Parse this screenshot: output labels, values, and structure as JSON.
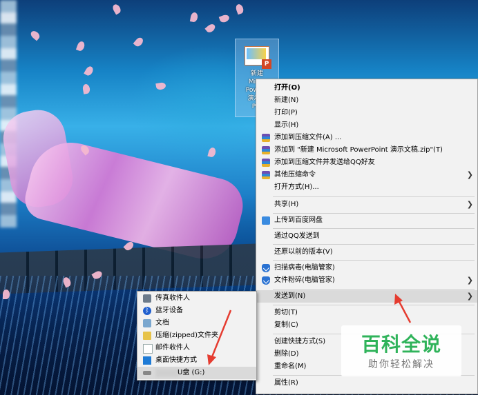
{
  "desktop": {
    "file_icon": {
      "name": "新建\nMic…\nPowe…\n演示…\nP…",
      "thumb_badge": "P"
    }
  },
  "main_menu": {
    "items": [
      {
        "label": "打开(O)"
      },
      {
        "label": "新建(N)"
      },
      {
        "label": "打印(P)"
      },
      {
        "label": "显示(H)"
      },
      {
        "label": "添加到压缩文件(A) ...",
        "icon": "winrar-icon"
      },
      {
        "label": "添加到 \"新建 Microsoft PowerPoint 演示文稿.zip\"(T)",
        "icon": "winrar-icon"
      },
      {
        "label": "添加到压缩文件并发送给QQ好友",
        "icon": "winrar-icon"
      },
      {
        "label": "其他压缩命令",
        "icon": "winrar-icon"
      },
      {
        "label": "打开方式(H)..."
      },
      {
        "label": "共享(H)"
      },
      {
        "label": "上传到百度网盘",
        "icon": "baidu-cloud-icon"
      },
      {
        "label": "通过QQ发送到"
      },
      {
        "label": "还原以前的版本(V)"
      },
      {
        "label": "扫描病毒(电脑管家)",
        "icon": "pc-manager-shield-icon"
      },
      {
        "label": "文件粉碎(电脑管家)",
        "icon": "pc-manager-shield-icon"
      },
      {
        "label": "发送到(N)"
      },
      {
        "label": "剪切(T)"
      },
      {
        "label": "复制(C)"
      },
      {
        "label": "创建快捷方式(S)"
      },
      {
        "label": "删除(D)"
      },
      {
        "label": "重命名(M)"
      },
      {
        "label": "属性(R)"
      }
    ],
    "highlighted": "发送到(N)"
  },
  "send_to_menu": {
    "items": [
      {
        "label": "传真收件人",
        "icon": "fax-icon"
      },
      {
        "label": "蓝牙设备",
        "icon": "bluetooth-icon"
      },
      {
        "label": "文档",
        "icon": "documents-icon"
      },
      {
        "label": "压缩(zipped)文件夹",
        "icon": "zip-folder-icon"
      },
      {
        "label": "邮件收件人",
        "icon": "mail-icon"
      },
      {
        "label": "桌面快捷方式",
        "icon": "desktop-icon"
      },
      {
        "label": "U盘 (G:)",
        "icon": "usb-drive-icon"
      }
    ],
    "highlighted": "U盘 (G:)"
  },
  "watermark": {
    "title": "百科全说",
    "subtitle": "助你轻松解决"
  },
  "colors": {
    "menu_bg": "#f2f2f2",
    "highlight": "#dadada",
    "arrow": "#e53c30",
    "watermark_green": "#2fb35a"
  }
}
